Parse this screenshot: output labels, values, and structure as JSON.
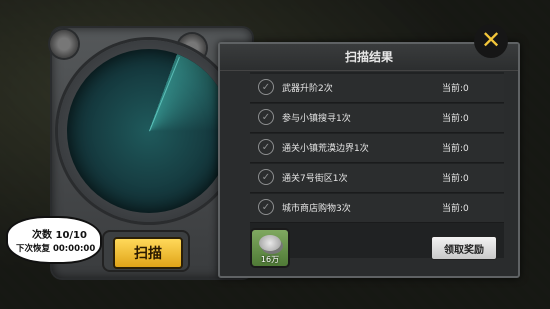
{
  "scan_button": {
    "label": "扫描"
  },
  "counter": {
    "count_text": "次数 10/10",
    "recover_text": "下次恢复 00:00:00"
  },
  "panel": {
    "title": "扫描结果",
    "tasks": [
      {
        "name": "武器升阶2次",
        "current": "当前:0"
      },
      {
        "name": "参与小镇搜寻1次",
        "current": "当前:0"
      },
      {
        "name": "通关小镇荒漠边界1次",
        "current": "当前:0"
      },
      {
        "name": "通关7号街区1次",
        "current": "当前:0"
      },
      {
        "name": "城市商店购物3次",
        "current": "当前:0"
      }
    ],
    "reward": {
      "amount": "16万",
      "icon": "silver-coin-icon"
    },
    "claim_label": "领取奖励"
  },
  "colors": {
    "accent": "#f3c63a",
    "scan_button": "#ffd95a",
    "radar": "#1f5a5c"
  }
}
